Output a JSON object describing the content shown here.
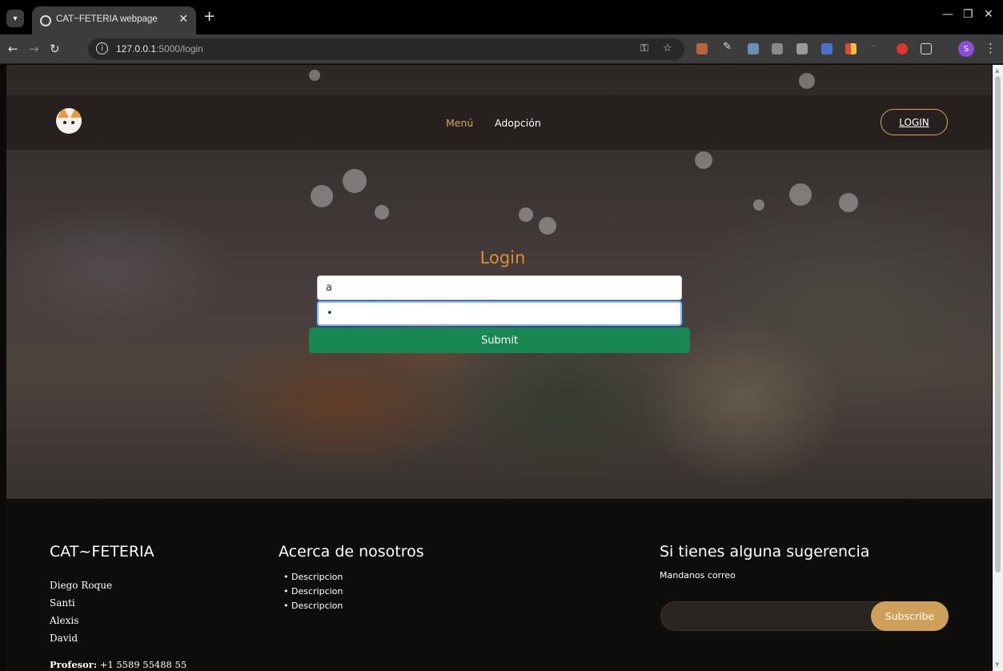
{
  "browser": {
    "tab_title": "CAT~FETERIA webpage",
    "url_host": "127.0.0.1",
    "url_path": ":5000/login",
    "profile_initial": "S"
  },
  "navbar": {
    "menu_label": "Menú",
    "adopt_label": "Adopción",
    "login_label": "LOGIN"
  },
  "login_form": {
    "title": "Login",
    "username_value": "a",
    "password_value": "•",
    "submit_label": "Submit"
  },
  "footer": {
    "brand": "CAT~FETERIA",
    "names": [
      "Diego Roque",
      "Santi",
      "Alexis",
      "David"
    ],
    "profesor_label": "Profesor:",
    "profesor_phone": "+1 5589 55488 55",
    "about_title": "Acerca de nosotros",
    "about_items": [
      "Descripcion",
      "Descripcion",
      "Descripcion"
    ],
    "suggest_title": "Si tienes alguna sugerencia",
    "suggest_subtitle": "Mandanos correo",
    "subscribe_label": "Subscribe"
  },
  "colors": {
    "accent": "#d9a557",
    "submit": "#198754",
    "footer_bg": "#0f0d0b"
  }
}
